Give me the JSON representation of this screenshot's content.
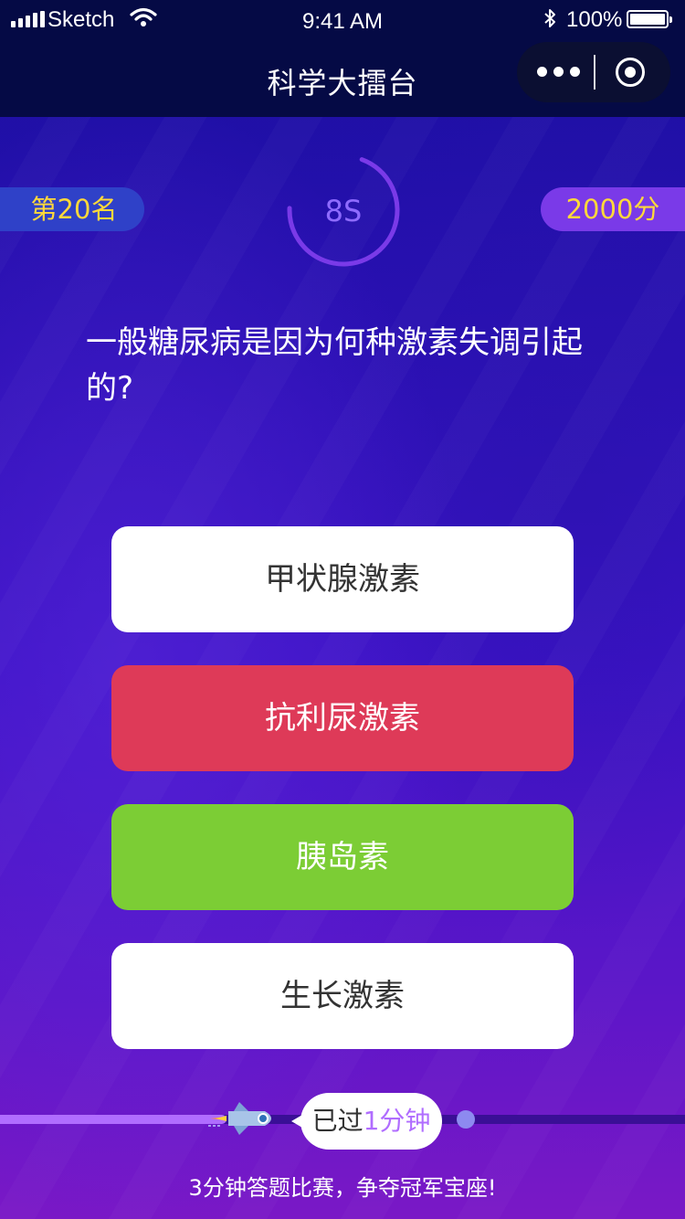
{
  "status_bar": {
    "carrier": "Sketch",
    "time": "9:41 AM",
    "battery": "100%"
  },
  "nav": {
    "title": "科学大擂台"
  },
  "game": {
    "rank": "第20名",
    "score": "2000分",
    "timer": "8S",
    "timer_remaining_fraction": 0.7
  },
  "question": {
    "text": "一般糖尿病是因为何种激素失调引起的?",
    "options": [
      {
        "label": "甲状腺激素",
        "state": "default"
      },
      {
        "label": "抗利尿激素",
        "state": "wrong"
      },
      {
        "label": "胰岛素",
        "state": "correct"
      },
      {
        "label": "生长激素",
        "state": "default"
      }
    ]
  },
  "progress": {
    "elapsed_prefix": "已过",
    "elapsed_value": "1分钟",
    "fraction": 0.33
  },
  "footer": {
    "slogan": "3分钟答题比赛，争夺冠军宝座!"
  },
  "colors": {
    "nav_bg": "#050a45",
    "correct": "#7ccd35",
    "wrong": "#de3a58",
    "accent": "#b06dff",
    "score_text": "#ffd93a"
  }
}
